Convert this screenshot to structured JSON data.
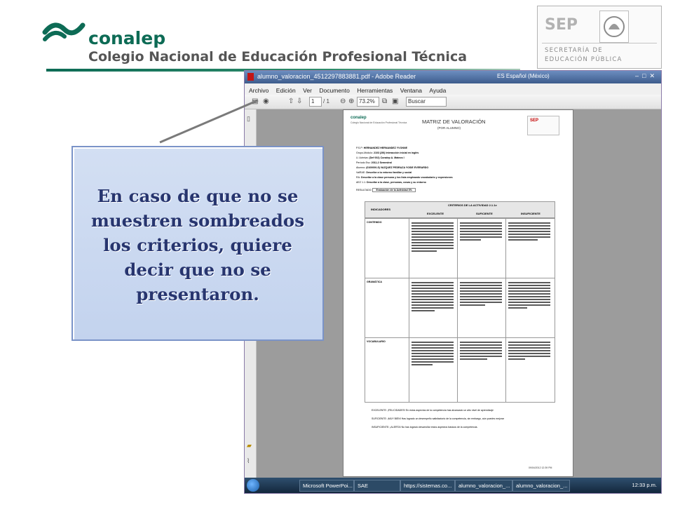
{
  "slide": {
    "brand_name": "conalep",
    "brand_subtitle": "Colegio Nacional de Educación Profesional Técnica",
    "sep_word": "SEP",
    "sep_line1": "SECRETARÍA DE",
    "sep_line2": "EDUCACIÓN PÚBLICA",
    "callout_text": "En caso de que no se muestren sombreados los criterios, quiere decir que no se presentaron.",
    "colors": {
      "brand_green": "#0d6b55",
      "callout_bg": "#c9d8f0",
      "callout_text": "#27356f"
    }
  },
  "window": {
    "title": "alumno_valoracion_4512297883881.pdf - Adobe Reader",
    "language": "ES Español (México)",
    "menu": [
      "Archivo",
      "Edición",
      "Ver",
      "Documento",
      "Herramientas",
      "Ventana",
      "Ayuda"
    ],
    "toolbar": {
      "page_current": "1",
      "page_total": "/ 1",
      "zoom": "73.2%",
      "search_placeholder": "Buscar"
    }
  },
  "document": {
    "logo_text": "conalep",
    "logo_subtext": "Colegio Nacional de Educación Profesional Técnica",
    "title": "MATRIZ DE VALORACIÓN",
    "subtitle": "(POR ALUMNO)",
    "sep_label": "SEP",
    "fields": [
      {
        "label": "P.S.P:",
        "value": "HERNANDEZ HERNANDEZ YVONNE"
      },
      {
        "label": "Grupo-Módulo:",
        "value": "2103 (2III) Interacción inicial en inglés"
      },
      {
        "label": "U. Admiva:",
        "value": "(Def 002) Conalep A. Mateos I"
      },
      {
        "label": "Período Esc:",
        "value": "2011-2 Semestral"
      },
      {
        "label": "Alumno:",
        "value": "(0100000-5) VAZQUEZ PEDRAZA YOSIE EVERARDO"
      },
      {
        "label": "ValRAE:",
        "value": "Describe a tu entorno familiar y social"
      },
      {
        "label": "RA:",
        "value": "Describe a la clase persona y los lista empleando vocabulario y expresiones"
      },
      {
        "label": "AEZ 1.1:",
        "value": "Describe a la clase, personas, cosas y su entorno"
      },
      {
        "label": "RESULTADO:",
        "value": "Evaluación de la Actividad 3%"
      }
    ],
    "criteria_title": "CRITERIOS DE LA ACTIVIDAD 2.1.1e",
    "indicators_header": "INDICADORES",
    "levels": [
      "EXCELENTE",
      "SUFICIENTE",
      "INSUFICIENTE"
    ],
    "rows": [
      "CONTENIDO",
      "GRAMÁTICA",
      "VOCABULARIO"
    ],
    "notes": [
      "EXCELENTE: ¡FELICIDADES! En estos aspectos de la competencia has alcanzado un alto nivel de aprendizaje",
      "SUFICIENTE: ¡MUY BIEN! Has logrado un desempeño satisfactorio de la competencia, sin embargo, aún puedes mejorar",
      "INSUFICIENTE: ¡ALERTA! No has logrado desarrollar estos aspectos básicos de la competencia."
    ],
    "stamp": "09/04/2012 12:39 PM"
  },
  "taskbar": {
    "items": [
      "Microsoft PowerPoi...",
      "SAE",
      "https://sistemas.co...",
      "alumno_valoracion_...",
      "alumno_valoracion_..."
    ],
    "clock": "12:33 p.m."
  }
}
